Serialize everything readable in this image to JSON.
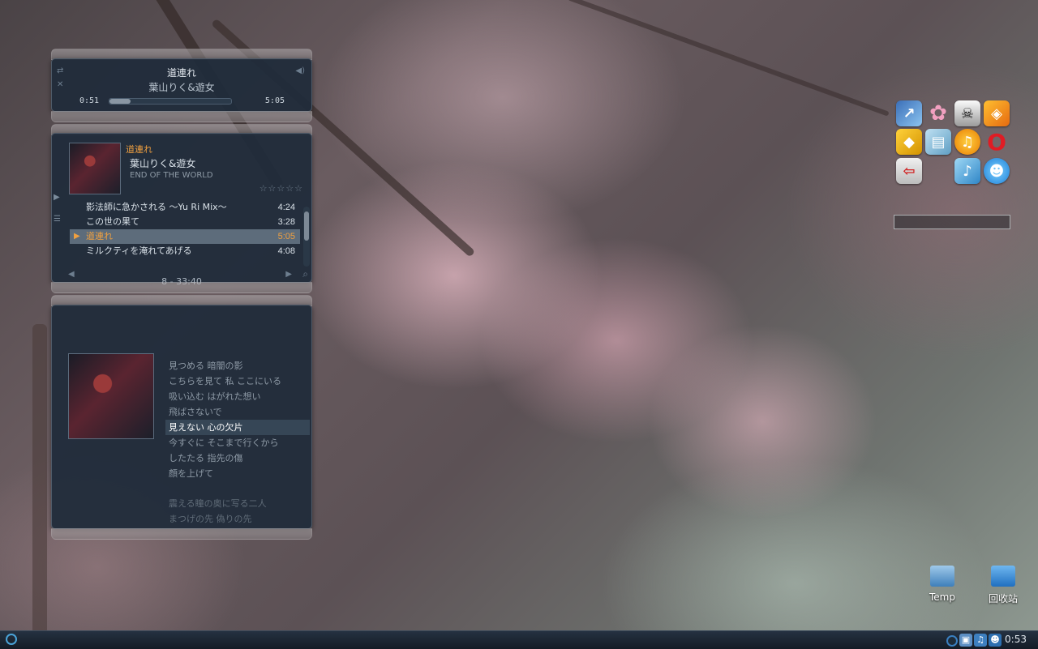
{
  "mini_player": {
    "title": "道連れ",
    "artist": "葉山りく&遊女",
    "elapsed": "0:51",
    "total": "5:05",
    "progress": 0.17
  },
  "playlist": {
    "now_title": "道連れ",
    "now_artist": "葉山りく&遊女",
    "now_album": "END OF THE WORLD",
    "rating": "☆☆☆☆☆",
    "tracks": [
      {
        "name": "影法師に急かされる 〜Yu Ri Mix〜",
        "duration": "4:24"
      },
      {
        "name": "この世の果て",
        "duration": "3:28"
      },
      {
        "name": "道連れ",
        "duration": "5:05"
      },
      {
        "name": "ミルクティを淹れてあげる",
        "duration": "4:08"
      }
    ],
    "footer": "8 - 33:40"
  },
  "lyrics": {
    "lines": [
      "見つめる 暗闇の影",
      "こちらを見て 私 ここにいる",
      "吸い込む はがれた想い",
      "飛ばさないで",
      "見えない 心の欠片",
      "今すぐに そこまで行くから",
      "したたる 指先の傷",
      "顔を上げて",
      "",
      "震える瞳の奥に写る二人",
      "まつげの先 偽りの先"
    ],
    "current_index": 4
  },
  "desktop": {
    "icons": [
      {
        "name": "Temp"
      },
      {
        "name": "回收站"
      }
    ]
  },
  "taskbar": {
    "clock": "0:53"
  },
  "colors": {
    "accent": "#f0a040",
    "panel": "#202c3a",
    "taskbar": "#1a2430"
  }
}
